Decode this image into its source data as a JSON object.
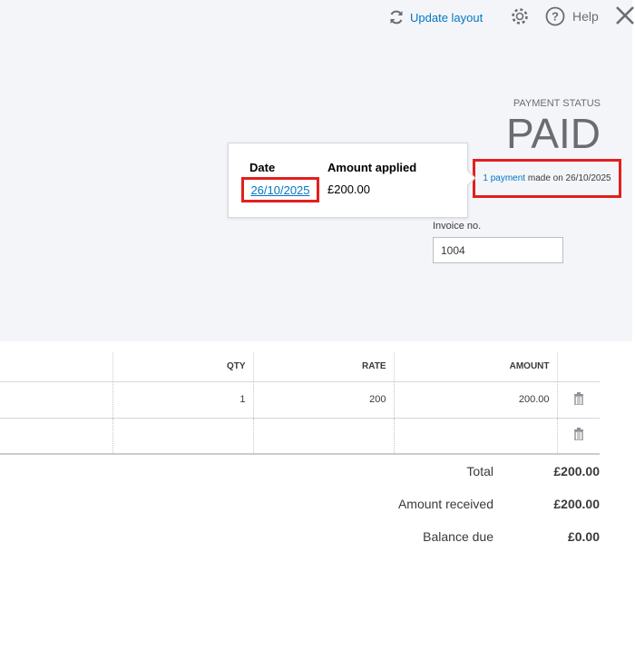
{
  "toolbar": {
    "update_layout": "Update layout",
    "help": "Help"
  },
  "payment_status": {
    "label": "PAYMENT STATUS",
    "status": "PAID",
    "payment_link": "1 payment",
    "payment_text": "made on 26/10/2025"
  },
  "popup": {
    "date_header": "Date",
    "amount_header": "Amount applied",
    "date": "26/10/2025",
    "amount": "£200.00"
  },
  "invoice": {
    "label": "Invoice no.",
    "value": "1004"
  },
  "table": {
    "headers": [
      "QTY",
      "RATE",
      "AMOUNT"
    ],
    "rows": [
      {
        "qty": "1",
        "rate": "200",
        "amount": "200.00"
      },
      {
        "qty": "",
        "rate": "",
        "amount": ""
      }
    ]
  },
  "totals": [
    {
      "label": "Total",
      "value": "£200.00"
    },
    {
      "label": "Amount received",
      "value": "£200.00"
    },
    {
      "label": "Balance due",
      "value": "£0.00"
    }
  ]
}
